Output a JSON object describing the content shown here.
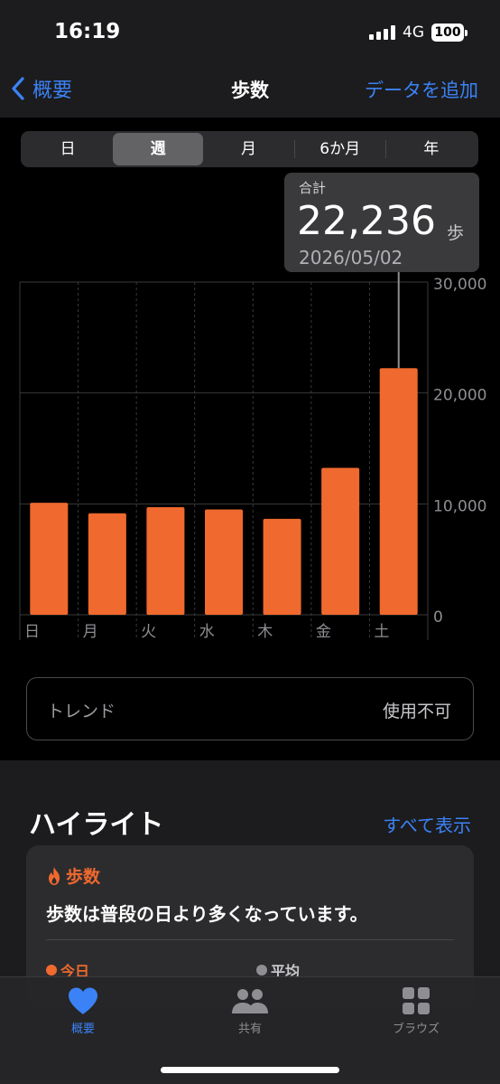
{
  "status_bar": {
    "time": "16:19",
    "network": "4G",
    "battery": "100"
  },
  "nav": {
    "back_label": "概要",
    "title": "歩数",
    "add_label": "データを追加"
  },
  "segments": [
    {
      "label": "日",
      "active": false
    },
    {
      "label": "週",
      "active": true
    },
    {
      "label": "月",
      "active": false
    },
    {
      "label": "6か月",
      "active": false
    },
    {
      "label": "年",
      "active": false
    }
  ],
  "tooltip": {
    "label": "合計",
    "value": "22,236",
    "unit": "歩",
    "date": "2026/05/02"
  },
  "chart_data": {
    "type": "bar",
    "categories": [
      "日",
      "月",
      "火",
      "水",
      "木",
      "金",
      "土"
    ],
    "values": [
      10100,
      9150,
      9700,
      9500,
      8650,
      13250,
      22236
    ],
    "ylim": [
      0,
      30000
    ],
    "yticks": [
      "30,000",
      "20,000",
      "10,000",
      "0"
    ],
    "ytick_values": [
      30000,
      20000,
      10000,
      0
    ],
    "selected_index": 6,
    "grid": true,
    "color": "#f0692e"
  },
  "trend": {
    "label": "トレンド",
    "value": "使用不可"
  },
  "highlights": {
    "title": "ハイライト",
    "show_all": "すべて表示",
    "card": {
      "category": "歩数",
      "text": "歩数は普段の日より多くなっています。",
      "legend_today": "今日",
      "legend_average": "平均",
      "today_color": "#f0692e",
      "average_color": "#8e8e93"
    }
  },
  "tab_bar": {
    "items": [
      {
        "label": "概要",
        "icon": "heart-icon",
        "active": true
      },
      {
        "label": "共有",
        "icon": "people-icon",
        "active": false
      },
      {
        "label": "ブラウズ",
        "icon": "grid-icon",
        "active": false
      }
    ]
  },
  "colors": {
    "accent": "#3b82f6",
    "bar": "#f0692e"
  }
}
